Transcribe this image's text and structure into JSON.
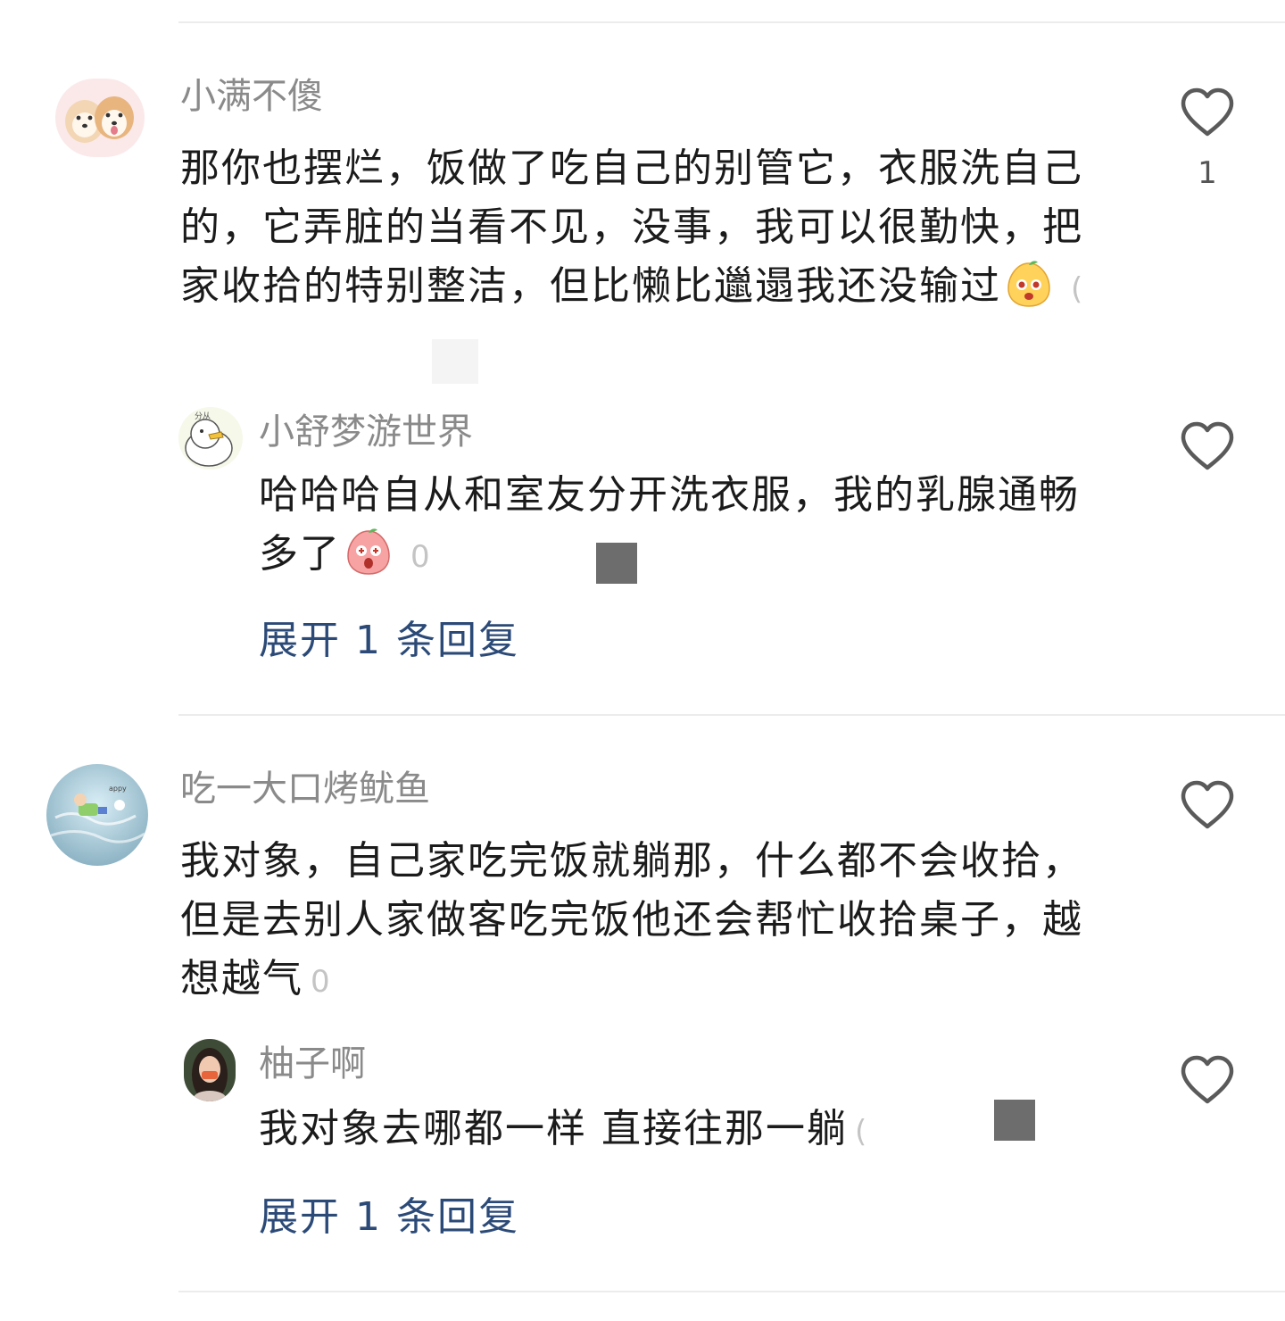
{
  "comments": [
    {
      "username": "小满不傻",
      "content": "那你也摆烂，饭做了吃自己的别管它，衣服洗自己的，它弄脏的当看不见，没事，我可以很勤快，把家收拾的特别整洁，但比懒比邋遢我还没输过",
      "emoji": "yellow-blob-emoji",
      "timestamp": "(",
      "like_count": "1",
      "reply": {
        "username": "小舒梦游世界",
        "content": "哈哈哈自从和室友分开洗衣服，我的乳腺通畅多了",
        "emoji": "pink-blob-emoji",
        "timestamp": "0"
      },
      "expand_label": "展开 1 条回复"
    },
    {
      "username": "吃一大口烤鱿鱼",
      "content": "我对象，自己家吃完饭就躺那，什么都不会收拾，但是去别人家做客吃完饭他还会帮忙收拾桌子，越想越气",
      "timestamp": "0",
      "reply": {
        "username": "柚子啊",
        "content": "我对象去哪都一样 直接往那一躺",
        "timestamp": "("
      },
      "expand_label": "展开 1 条回复"
    }
  ],
  "colors": {
    "username": "#8a8a8a",
    "content": "#1b1b1b",
    "link": "#2c4a77",
    "divider": "#ececec"
  },
  "icons": {
    "like": "heart-outline-icon"
  }
}
